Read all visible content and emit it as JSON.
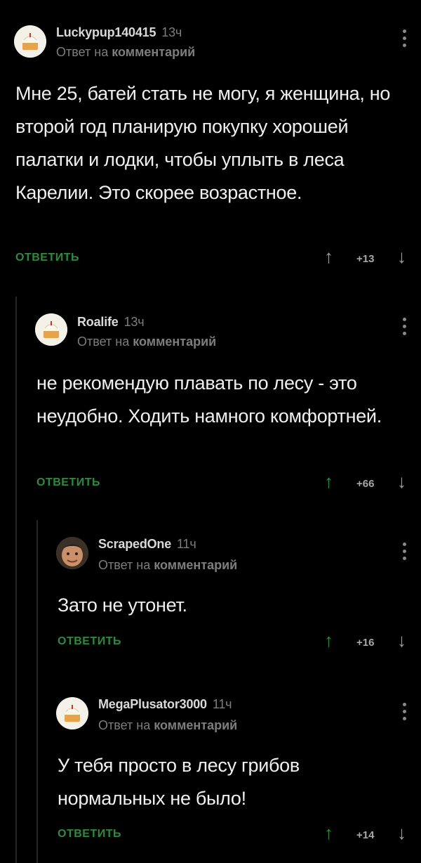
{
  "ui": {
    "reply_prefix": "Ответ на",
    "reply_target": "комментарий",
    "reply_button": "ОТВЕТИТЬ",
    "up_arrow": "↑",
    "down_arrow": "↓"
  },
  "comments": [
    {
      "username": "Luckypup140415",
      "time": "13ч",
      "avatar": "cake-avatar-icon",
      "text": "Мне 25, батей стать не могу, я женщина, но второй год планирую покупку хорошей палатки и лодки, чтобы уплыть в леса Карелии. Это скорее возрастное.",
      "score": "+13"
    },
    {
      "username": "Roalife",
      "time": "13ч",
      "avatar": "cake-avatar-icon",
      "text": "не рекомендую плавать по лесу - это неудобно. Ходить намного комфортней.",
      "score": "+66"
    },
    {
      "username": "ScrapedOne",
      "time": "11ч",
      "avatar": "face-avatar-icon",
      "text": "Зато не утонет.",
      "score": "+16"
    },
    {
      "username": "MegaPlusator3000",
      "time": "11ч",
      "avatar": "cake-avatar-icon",
      "text": "У тебя просто в лесу грибов нормальных не было!",
      "score": "+14"
    }
  ],
  "colors": {
    "background": "#000000",
    "accent_green": "#2f8a3c",
    "muted": "#7d7d7d",
    "text": "#efefef"
  }
}
